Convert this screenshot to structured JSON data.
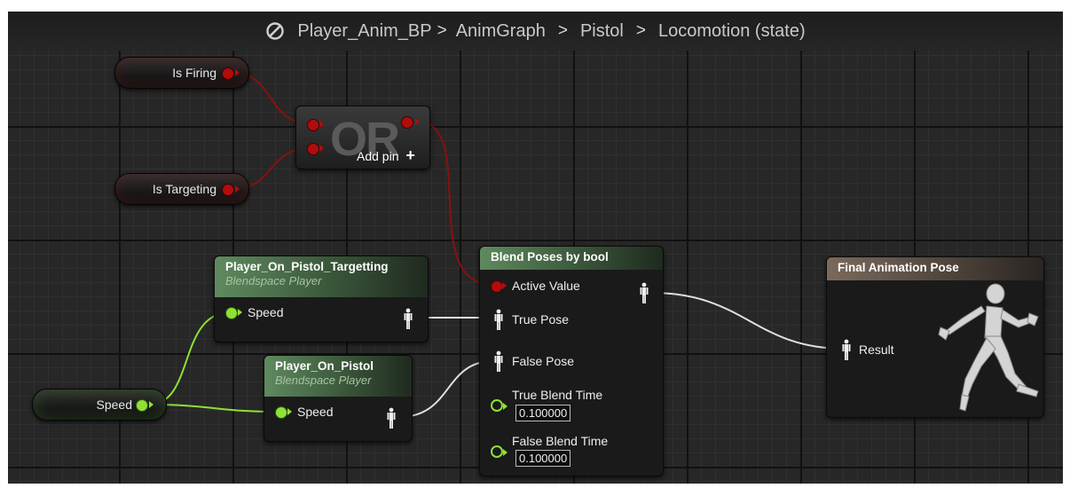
{
  "breadcrumb": {
    "items": [
      "Player_Anim_BP",
      "AnimGraph",
      "Pistol",
      "Locomotion (state)"
    ],
    "separator": ">"
  },
  "variables": {
    "is_firing": "Is Firing",
    "is_targeting": "Is Targeting",
    "speed": "Speed"
  },
  "or_node": {
    "title": "OR",
    "add_pin": "Add pin",
    "add_icon": "+"
  },
  "blendspace_targetting": {
    "title": "Player_On_Pistol_Targetting",
    "subtitle": "Blendspace Player",
    "input": "Speed"
  },
  "blendspace_pistol": {
    "title": "Player_On_Pistol",
    "subtitle": "Blendspace Player",
    "input": "Speed"
  },
  "blend_by_bool": {
    "title": "Blend Poses by bool",
    "active_value": "Active Value",
    "true_pose": "True Pose",
    "false_pose": "False Pose",
    "true_blend_time": "True Blend Time",
    "true_blend_value": "0.100000",
    "false_blend_time": "False Blend Time",
    "false_blend_value": "0.100000"
  },
  "final_pose": {
    "title": "Final Animation Pose",
    "result": "Result"
  },
  "colors": {
    "bool_pin": "#b00d0d",
    "float_pin": "#8fe035",
    "pose_wire": "#e0e0e0",
    "graph_bg": "#272727"
  },
  "icons": {
    "breadcrumb": "blueprint-no-icon",
    "pose": "pose-mannequin-icon",
    "preview": "running-mannequin-icon"
  }
}
